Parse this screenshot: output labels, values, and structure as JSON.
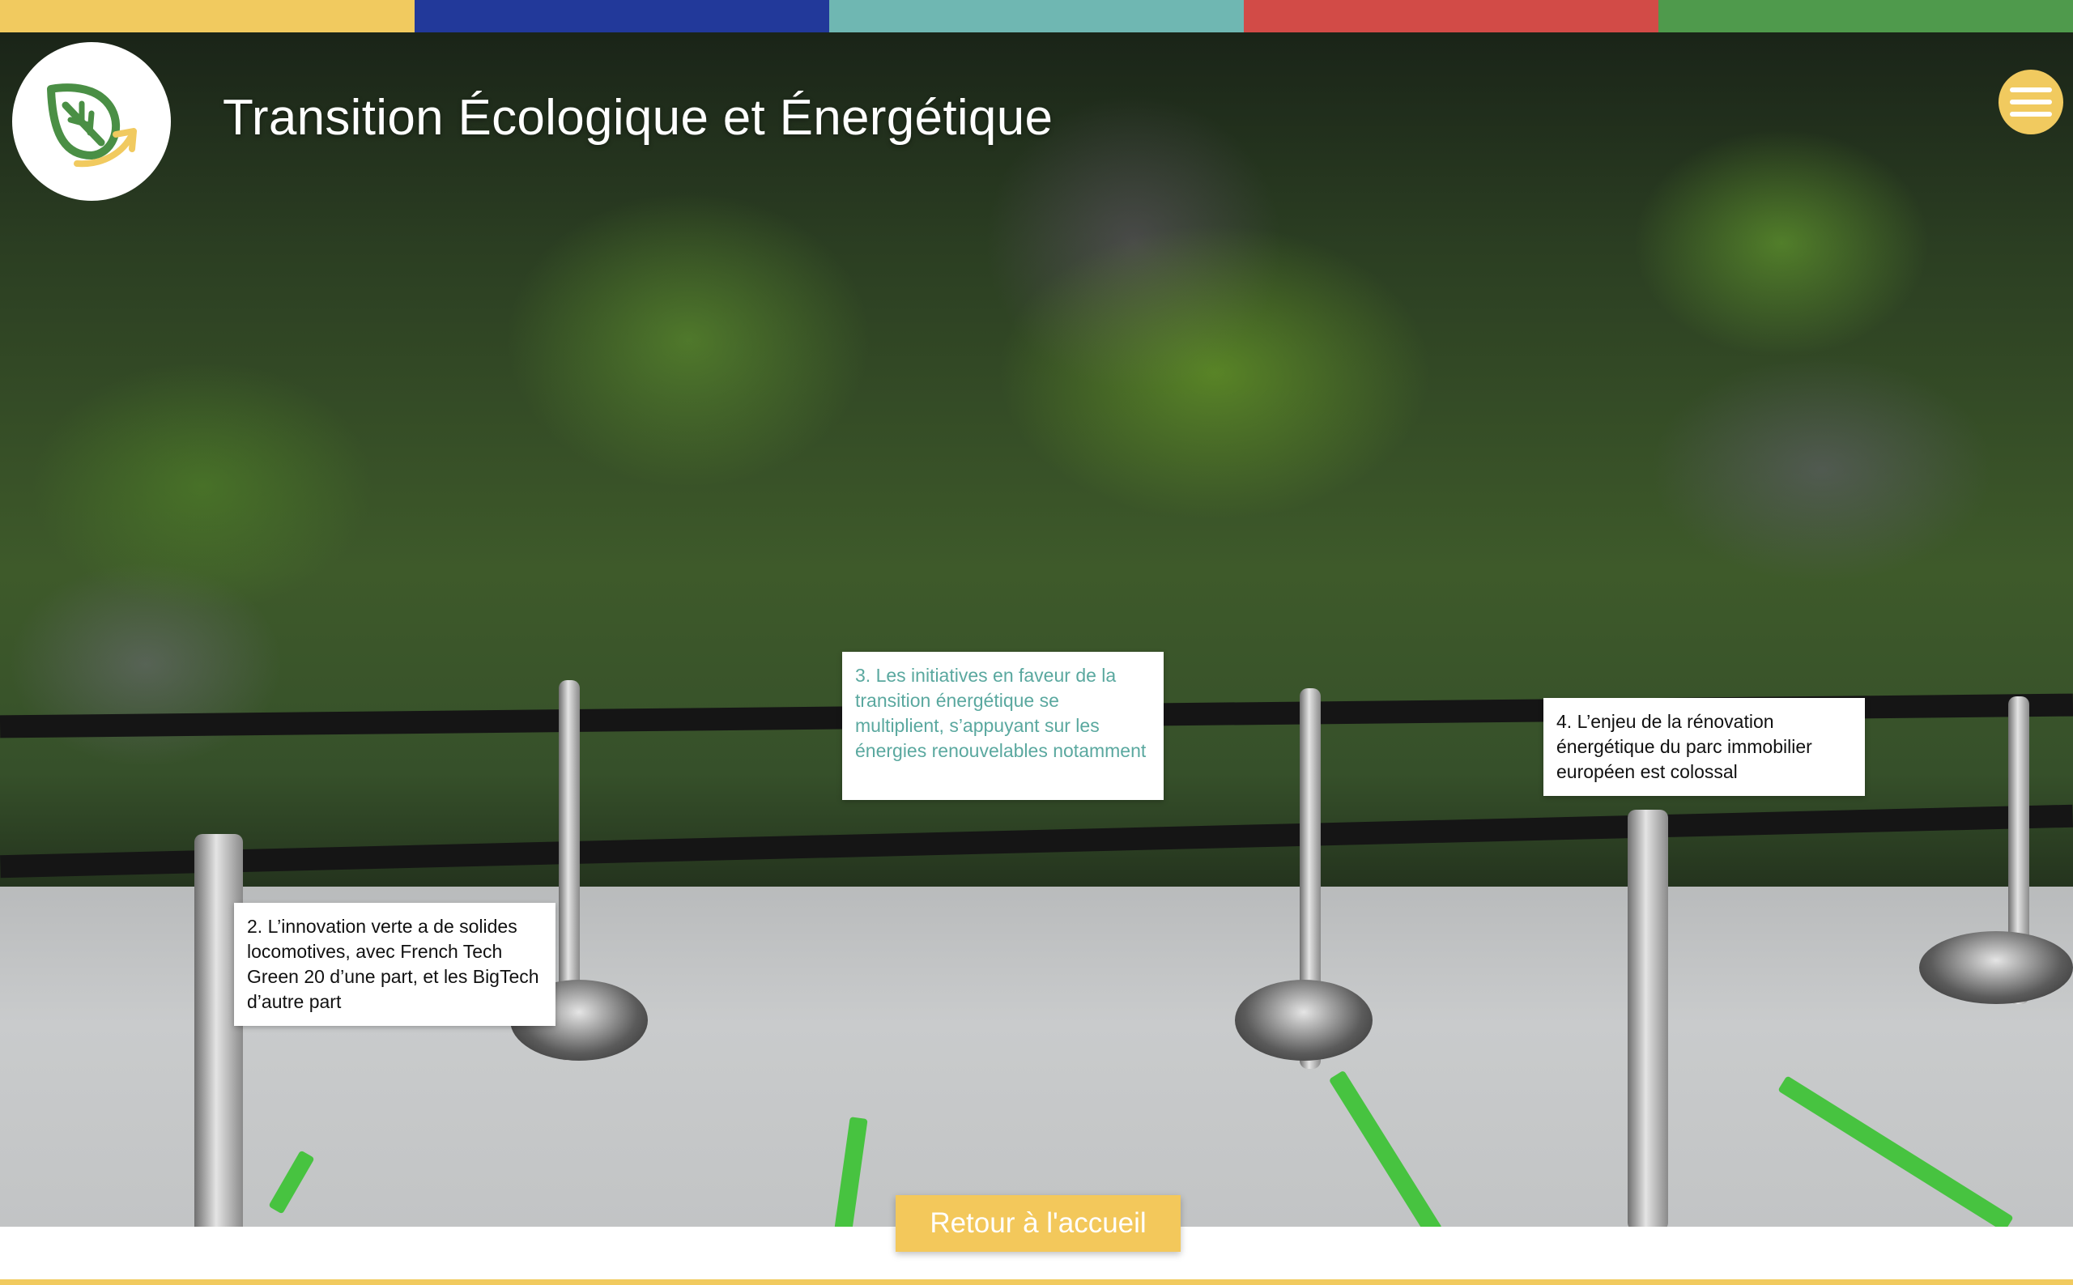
{
  "header": {
    "title": "Transition Écologique et Énergétique",
    "logo_icon": "leaf-arrow-icon",
    "menu_icon": "hamburger-icon"
  },
  "theme": {
    "stripe_colors": [
      "#f1ca5f",
      "#22399a",
      "#6fb7b2",
      "#d24b47",
      "#4f9a4c"
    ],
    "accent": "#f1ca5f",
    "active_text": "#5aa89f",
    "leaf_green": "#4a8f45"
  },
  "cards": [
    {
      "id": "card-2",
      "text": "2. L’innovation verte a de solides locomotives, avec French Tech Green 20 d’une part, et les BigTech d’autre part",
      "active": false
    },
    {
      "id": "card-3",
      "text": "3. Les initiatives en faveur de la transition énergétique se multiplient, s’appuyant sur les énergies renouvelables notamment",
      "active": true
    },
    {
      "id": "card-4",
      "text": "4. L’enjeu de la rénovation énergétique du parc immobilier européen est colossal",
      "active": false
    }
  ],
  "footer": {
    "home_label": "Retour à l'accueil"
  }
}
